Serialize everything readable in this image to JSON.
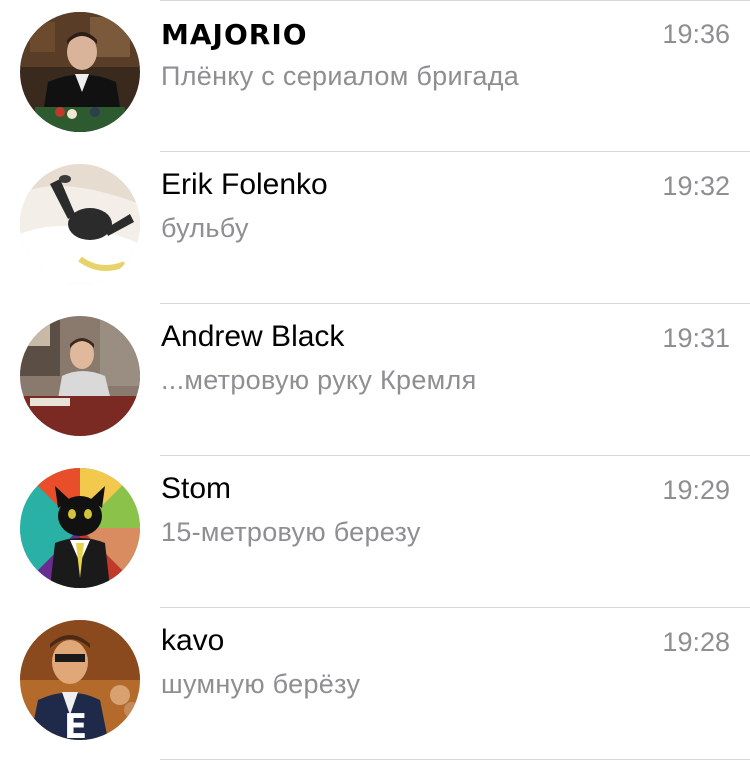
{
  "chats": [
    {
      "name": "MAJORIO",
      "time": "19:36",
      "preview": "Плёнку с сериалом бригада",
      "avatar": "man-in-suit-avatar"
    },
    {
      "name": "Erik Folenko",
      "time": "19:32",
      "preview": "бульбу",
      "avatar": "cat-in-blanket-avatar"
    },
    {
      "name": "Andrew Black",
      "time": "19:31",
      "preview": "...метровую руку Кремля",
      "avatar": "man-at-table-avatar"
    },
    {
      "name": "Stom",
      "time": "19:29",
      "preview": "15-метровую березу",
      "avatar": "business-cat-avatar"
    },
    {
      "name": "kavo",
      "time": "19:28",
      "preview": "шумную берёзу",
      "avatar": "cartoon-man-avatar"
    }
  ],
  "colors": {
    "name": "#000000",
    "secondary_text": "#8e8e93",
    "divider": "#d9d9d9",
    "background": "#ffffff"
  }
}
